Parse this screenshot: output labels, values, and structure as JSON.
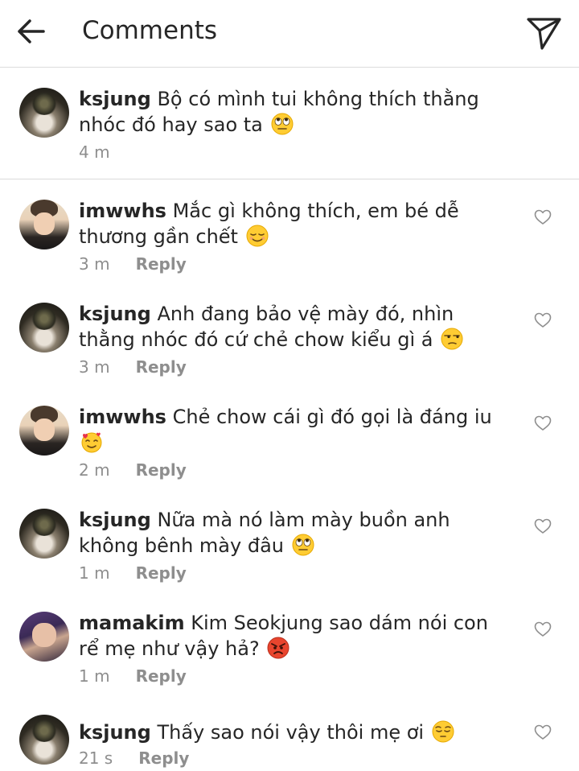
{
  "header": {
    "title": "Comments",
    "back_icon": "arrow-left-icon",
    "send_icon": "paper-plane-icon"
  },
  "caption": {
    "username": "ksjung",
    "text": "Bộ có mình tui không thích thằng nhóc đó hay sao ta",
    "emoji": "eye-roll-emoji",
    "time": "4 m"
  },
  "comments": [
    {
      "username": "imwwhs",
      "text": "Mắc gì không thích, em bé dễ thương gần chết",
      "emoji": "relieved-emoji",
      "time": "3 m",
      "reply": "Reply"
    },
    {
      "username": "ksjung",
      "text": "Anh đang bảo vệ mày đó, nhìn thằng nhóc đó cứ chẻ chow kiểu gì á",
      "emoji": "unamused-emoji",
      "time": "3 m",
      "reply": "Reply"
    },
    {
      "username": "imwwhs",
      "text": "Chẻ chow cái gì đó gọi là đáng iu",
      "emoji": "smiling-hearts-emoji",
      "time": "2 m",
      "reply": "Reply"
    },
    {
      "username": "ksjung",
      "text": "Nữa mà nó làm mày buồn anh không bênh mày đâu",
      "emoji": "eye-roll-emoji",
      "time": "1 m",
      "reply": "Reply"
    },
    {
      "username": "mamakim",
      "text": "Kim Seokjung sao dám nói con rể mẹ như vậy hả?",
      "emoji": "angry-emoji",
      "time": "1 m",
      "reply": "Reply"
    },
    {
      "username": "ksjung",
      "text": "Thấy sao nói vậy thôi mẹ ơi",
      "emoji": "pensive-emoji",
      "time": "21 s",
      "reply": "Reply"
    }
  ],
  "colors": {
    "text": "#262626",
    "muted": "#8e8e8e",
    "divider": "#dbdbdb",
    "emoji": "#FFCC33"
  }
}
